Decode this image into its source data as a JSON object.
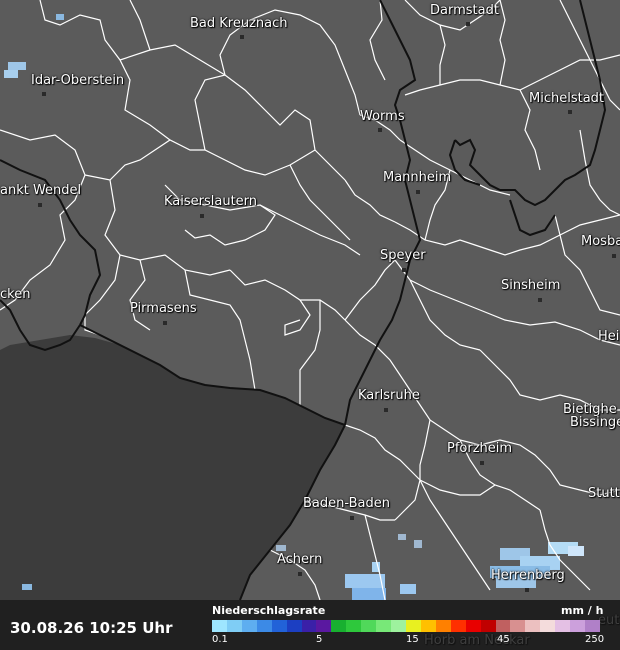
{
  "map": {
    "colors": {
      "land": "#5b5b5b",
      "outside_area": "#3c3c3c",
      "district_border": "#ffffff",
      "state_border": "#111111",
      "city_dot": "#2a2a2a"
    },
    "cities": [
      {
        "id": "bad-kreuznach",
        "name": "Bad Kreuznach"
      },
      {
        "id": "darmstadt",
        "name": "Darmstadt"
      },
      {
        "id": "idar-oberstein",
        "name": "Idar-Oberstein"
      },
      {
        "id": "michelstadt",
        "name": "Michelstadt"
      },
      {
        "id": "worms",
        "name": "Worms"
      },
      {
        "id": "sankt-wendel",
        "name": "ankt Wendel"
      },
      {
        "id": "mannheim",
        "name": "Mannheim"
      },
      {
        "id": "kaiserslautern",
        "name": "Kaiserslautern"
      },
      {
        "id": "mosbach",
        "name": "Mosba"
      },
      {
        "id": "speyer",
        "name": "Speyer"
      },
      {
        "id": "sinsheim",
        "name": "Sinsheim"
      },
      {
        "id": "homburg",
        "name": "cken"
      },
      {
        "id": "pirmasens",
        "name": "Pirmasens"
      },
      {
        "id": "heilbronn",
        "name": "Hei"
      },
      {
        "id": "karlsruhe",
        "name": "Karlsruhe"
      },
      {
        "id": "bietigheim",
        "name": "Bietighe"
      },
      {
        "id": "bissingen",
        "name": "Bissinge"
      },
      {
        "id": "pforzheim",
        "name": "Pforzheim"
      },
      {
        "id": "stuttgart",
        "name": "Stutt"
      },
      {
        "id": "baden-baden",
        "name": "Baden-Baden"
      },
      {
        "id": "achern",
        "name": "Achern"
      },
      {
        "id": "herrenberg",
        "name": "Herrenberg"
      },
      {
        "id": "horb",
        "name": "Horb am Neckar"
      },
      {
        "id": "reutlingen",
        "name": "eut"
      }
    ]
  },
  "legend": {
    "timestamp": "30.08.26 10:25 Uhr",
    "title": "Niederschlagsrate",
    "unit": "mm / h",
    "ticks": [
      "0.1",
      "5",
      "15",
      "45",
      "250"
    ],
    "scale_colors": [
      "#9ee6ff",
      "#7fcdf5",
      "#5eaef0",
      "#3c8ae6",
      "#2262d8",
      "#1c3fc2",
      "#3a20a8",
      "#5a18a0",
      "#18b030",
      "#2ec83c",
      "#50d85a",
      "#78e878",
      "#9ef29e",
      "#e8f020",
      "#ffc000",
      "#ff8000",
      "#ff3000",
      "#e80000",
      "#c00000",
      "#c06060",
      "#d89090",
      "#ecc0c0",
      "#f4dcdc",
      "#e4c0e4",
      "#cca0dc",
      "#b080c8"
    ]
  }
}
